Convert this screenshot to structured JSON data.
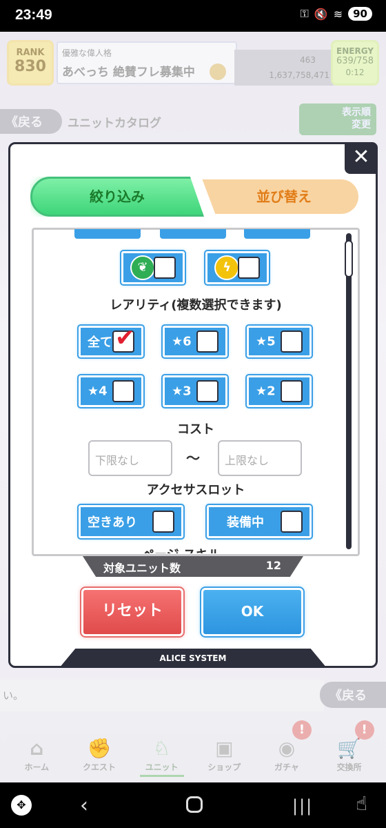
{
  "status_bar": {
    "time": "23:49",
    "battery": "90"
  },
  "header": {
    "rank_label": "RANK",
    "rank_value": "830",
    "player_title": "優雅な偉人格",
    "player_name": "あべっち 絶賛フレ募集中",
    "gems": "463",
    "gold": "1,637,758,471",
    "energy_label": "ENERGY",
    "energy_value": "639/758",
    "energy_timer": "0:12"
  },
  "subheader": {
    "back_label": "《戻る",
    "title": "ユニットカタログ",
    "display_order_label": "表示順\n変更"
  },
  "chat": {
    "text": "い。",
    "back_label": "《戻る"
  },
  "bottom_nav": [
    {
      "label": "ホーム",
      "icon": "home-icon"
    },
    {
      "label": "クエスト",
      "icon": "quest-icon"
    },
    {
      "label": "ユニット",
      "icon": "unit-icon"
    },
    {
      "label": "ショップ",
      "icon": "shop-icon"
    },
    {
      "label": "ガチャ",
      "icon": "gacha-icon",
      "badge": "!"
    },
    {
      "label": "交換所",
      "icon": "exchange-icon",
      "badge": "!"
    }
  ],
  "modal": {
    "close_label": "✕",
    "tabs": {
      "filter": "絞り込み",
      "sort": "並び替え"
    },
    "rarity_title": "レアリティ(複数選択できます)",
    "rarity_options": [
      {
        "label": "全て",
        "checked": true
      },
      {
        "label": "★6",
        "checked": false
      },
      {
        "label": "★5",
        "checked": false
      },
      {
        "label": "★4",
        "checked": false
      },
      {
        "label": "★3",
        "checked": false
      },
      {
        "label": "★2",
        "checked": false
      }
    ],
    "cost_title": "コスト",
    "cost_min_placeholder": "下限なし",
    "cost_max_placeholder": "上限なし",
    "cost_separator": "～",
    "accessory_title": "アクセサスロット",
    "accessory_options": [
      {
        "label": "空きあり",
        "checked": false
      },
      {
        "label": "装備中",
        "checked": false
      }
    ],
    "partial_next_title": "ページ スキル",
    "count_label": "対象ユニット数",
    "count_value": "12",
    "reset_label": "リセット",
    "ok_label": "OK",
    "footer": "ALICE SYSTEM"
  },
  "colors": {
    "accent_blue": "#3a9fe6",
    "filter_tab_green": "#3ed579",
    "sort_tab_orange": "#e17d18",
    "reset_red": "#e04b4b",
    "check_red": "#e02030",
    "dark_frame": "#2d2f3c"
  }
}
